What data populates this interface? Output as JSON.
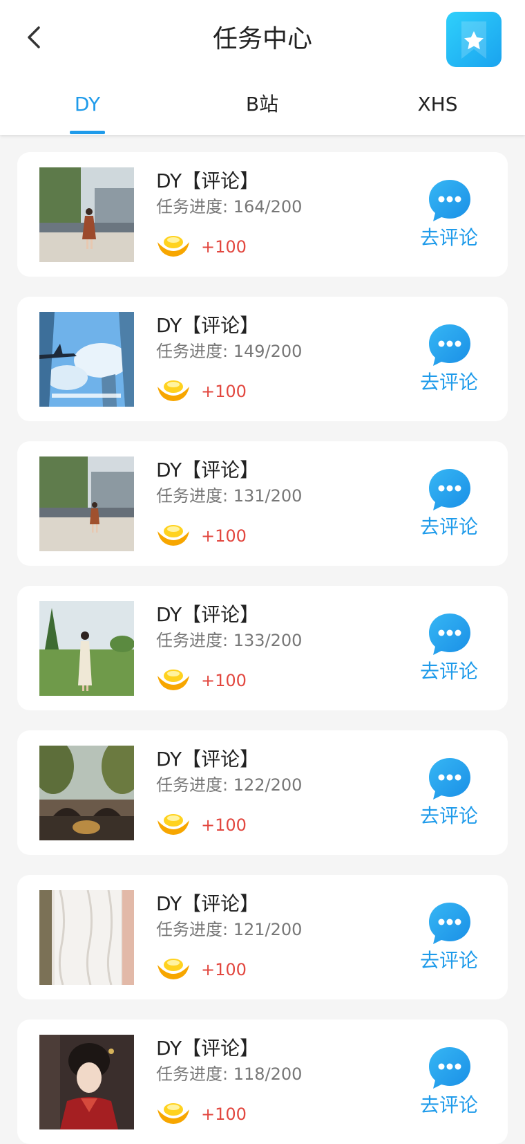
{
  "header": {
    "title": "任务中心",
    "back_icon": "chevron-left-icon",
    "favorites_icon": "star-bookmark-icon"
  },
  "tabs": [
    {
      "label": "DY",
      "active": true
    },
    {
      "label": "B站",
      "active": false
    },
    {
      "label": "XHS",
      "active": false
    }
  ],
  "colors": {
    "accent": "#1f9bea",
    "reward": "#e2473f",
    "fav_gradient_start": "#2fd0fb",
    "fav_gradient_end": "#1aa3ef"
  },
  "tasks": [
    {
      "title": "DY【评论】",
      "progress": "任务进度: 164/200",
      "reward": "+100",
      "action": "去评论",
      "thumb": "street-woman-photo"
    },
    {
      "title": "DY【评论】",
      "progress": "任务进度: 149/200",
      "reward": "+100",
      "action": "去评论",
      "thumb": "airplane-sky-photo"
    },
    {
      "title": "DY【评论】",
      "progress": "任务进度: 131/200",
      "reward": "+100",
      "action": "去评论",
      "thumb": "street-woman-photo"
    },
    {
      "title": "DY【评论】",
      "progress": "任务进度: 133/200",
      "reward": "+100",
      "action": "去评论",
      "thumb": "park-woman-photo"
    },
    {
      "title": "DY【评论】",
      "progress": "任务进度: 122/200",
      "reward": "+100",
      "action": "去评论",
      "thumb": "bridge-canal-photo"
    },
    {
      "title": "DY【评论】",
      "progress": "任务进度: 121/200",
      "reward": "+100",
      "action": "去评论",
      "thumb": "lace-dress-photo"
    },
    {
      "title": "DY【评论】",
      "progress": "任务进度: 118/200",
      "reward": "+100",
      "action": "去评论",
      "thumb": "hanfu-woman-photo"
    }
  ]
}
